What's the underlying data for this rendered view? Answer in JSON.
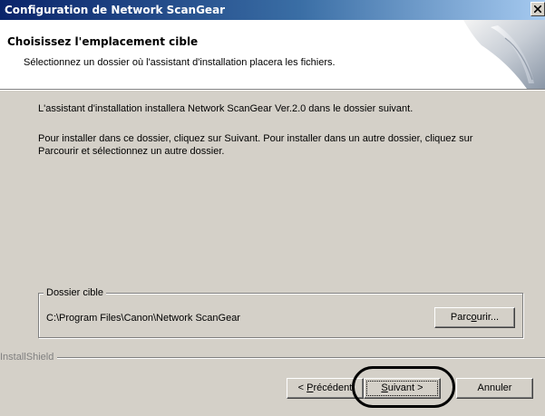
{
  "window": {
    "title": "Configuration de Network ScanGear",
    "close_glyph": "close-icon"
  },
  "header": {
    "title": "Choisissez l'emplacement cible",
    "subtitle": "Sélectionnez un dossier où l'assistant d'installation placera les fichiers."
  },
  "body": {
    "line1": "L'assistant d'installation installera Network ScanGear Ver.2.0 dans le dossier suivant.",
    "line2": "Pour installer dans ce dossier, cliquez sur Suivant. Pour installer dans un autre dossier, cliquez sur Parcourir et sélectionnez un autre dossier."
  },
  "destination": {
    "legend": "Dossier cible",
    "path": "C:\\Program Files\\Canon\\Network ScanGear",
    "browse_label_pre": "Parc",
    "browse_label_u": "o",
    "browse_label_post": "urir..."
  },
  "footer": {
    "brand": "InstallShield",
    "back_label_pre": "< ",
    "back_label_u": "P",
    "back_label_post": "récédent",
    "next_label_u": "S",
    "next_label_post": "uivant >",
    "cancel_label": "Annuler"
  },
  "colors": {
    "titlebar_start": "#0a246a",
    "titlebar_end": "#a6caf0",
    "dialog_face": "#d4d0c8",
    "highlight_oval": "#000000"
  }
}
